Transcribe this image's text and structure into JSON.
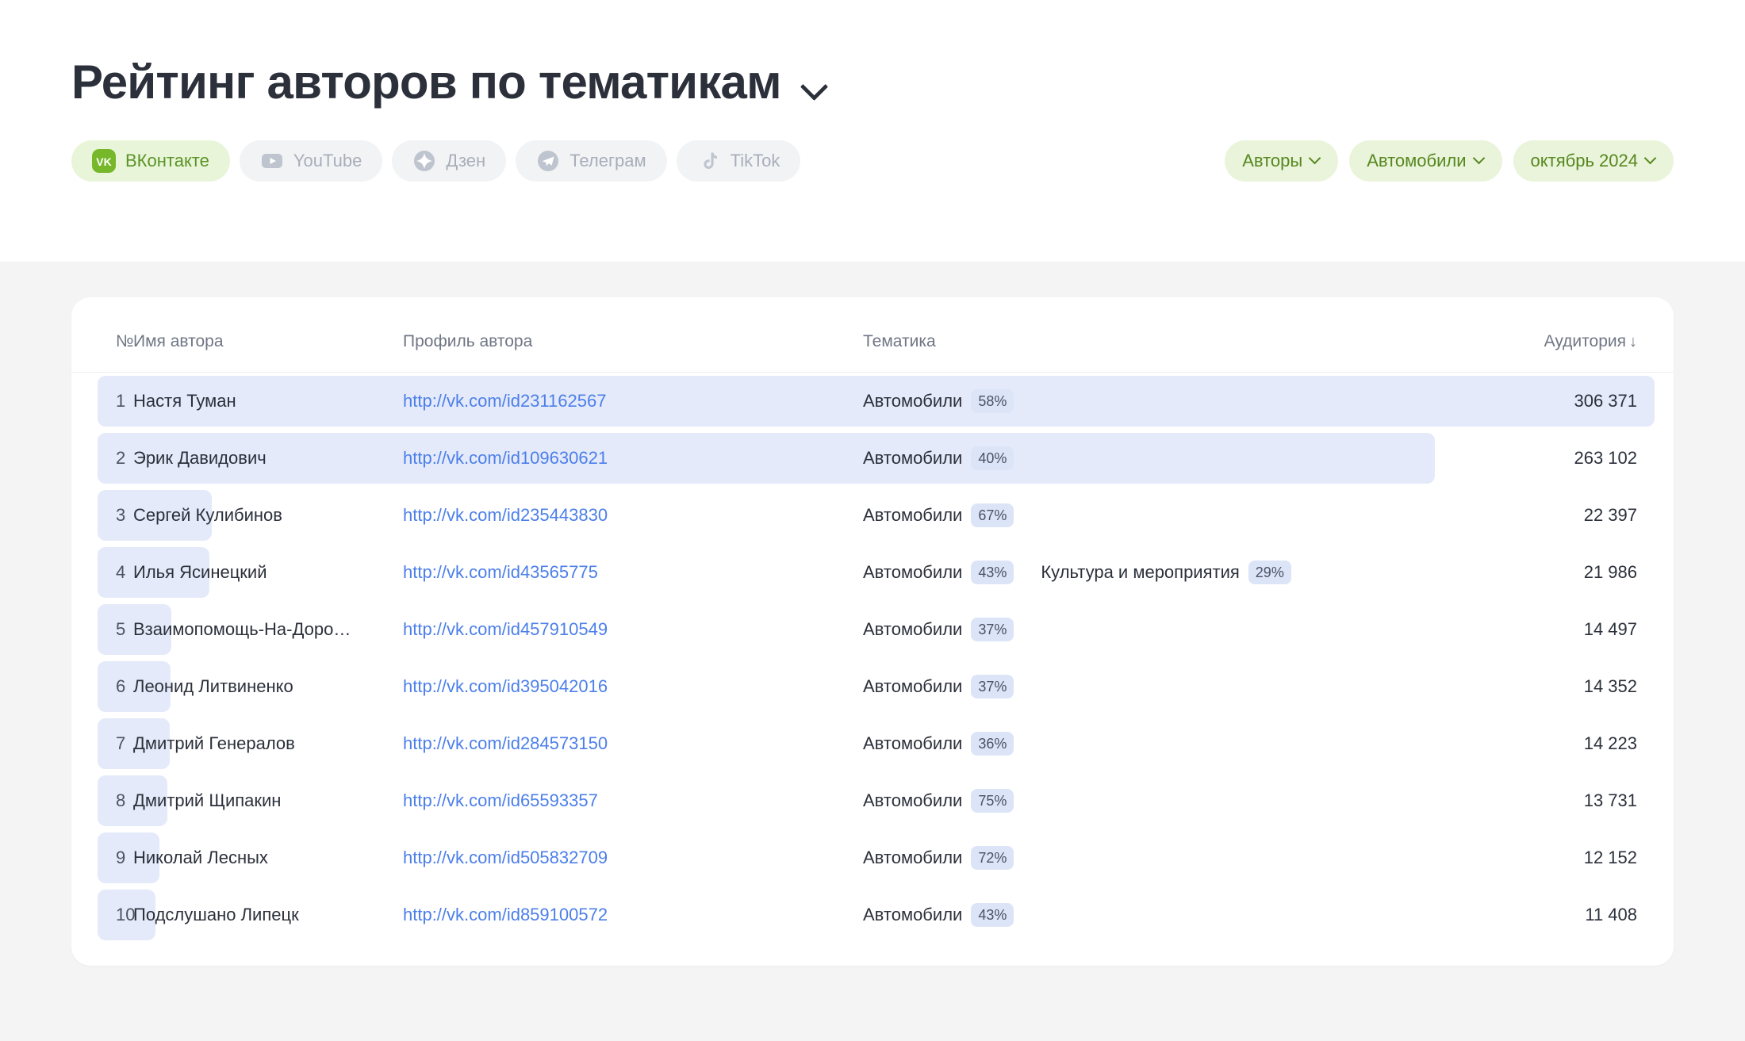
{
  "header": {
    "title": "Рейтинг авторов по тематикам",
    "title_chevron_icon": "chevron-down-icon"
  },
  "platforms": [
    {
      "label": "ВКонтакте",
      "icon": "vk-icon",
      "active": true
    },
    {
      "label": "YouTube",
      "icon": "youtube-icon",
      "active": false
    },
    {
      "label": "Дзен",
      "icon": "dzen-icon",
      "active": false
    },
    {
      "label": "Телеграм",
      "icon": "telegram-icon",
      "active": false
    },
    {
      "label": "TikTok",
      "icon": "tiktok-icon",
      "active": false
    }
  ],
  "filters": [
    {
      "label": "Авторы",
      "name": "entity-filter"
    },
    {
      "label": "Автомобили",
      "name": "topic-filter"
    },
    {
      "label": "октябрь 2024",
      "name": "period-filter"
    }
  ],
  "table": {
    "columns": {
      "num": "№",
      "name": "Имя автора",
      "profile": "Профиль автора",
      "topic": "Тематика",
      "audience": "Аудитория",
      "sort_arrow": "↓"
    },
    "rows": [
      {
        "num": "1",
        "name": "Настя Туман",
        "profile": "http://vk.com/id231162567",
        "topics": [
          {
            "label": "Автомобили",
            "pct": "58%"
          }
        ],
        "audience": "306 371",
        "audience_value": 306371
      },
      {
        "num": "2",
        "name": "Эрик Давидович",
        "profile": "http://vk.com/id109630621",
        "topics": [
          {
            "label": "Автомобили",
            "pct": "40%"
          }
        ],
        "audience": "263 102",
        "audience_value": 263102
      },
      {
        "num": "3",
        "name": "Сергей Кулибинов",
        "profile": "http://vk.com/id235443830",
        "topics": [
          {
            "label": "Автомобили",
            "pct": "67%"
          }
        ],
        "audience": "22 397",
        "audience_value": 22397
      },
      {
        "num": "4",
        "name": "Илья Ясинецкий",
        "profile": "http://vk.com/id43565775",
        "topics": [
          {
            "label": "Автомобили",
            "pct": "43%"
          },
          {
            "label": "Культура и мероприятия",
            "pct": "29%"
          }
        ],
        "audience": "21 986",
        "audience_value": 21986
      },
      {
        "num": "5",
        "name": "Взаимопомощь-На-Доро…",
        "profile": "http://vk.com/id457910549",
        "topics": [
          {
            "label": "Автомобили",
            "pct": "37%"
          }
        ],
        "audience": "14 497",
        "audience_value": 14497
      },
      {
        "num": "6",
        "name": "Леонид Литвиненко",
        "profile": "http://vk.com/id395042016",
        "topics": [
          {
            "label": "Автомобили",
            "pct": "37%"
          }
        ],
        "audience": "14 352",
        "audience_value": 14352
      },
      {
        "num": "7",
        "name": "Дмитрий Генералов",
        "profile": "http://vk.com/id284573150",
        "topics": [
          {
            "label": "Автомобили",
            "pct": "36%"
          }
        ],
        "audience": "14 223",
        "audience_value": 14223
      },
      {
        "num": "8",
        "name": "Дмитрий Щипакин",
        "profile": "http://vk.com/id65593357",
        "topics": [
          {
            "label": "Автомобили",
            "pct": "75%"
          }
        ],
        "audience": "13 731",
        "audience_value": 13731
      },
      {
        "num": "9",
        "name": "Николай Лесных",
        "profile": "http://vk.com/id505832709",
        "topics": [
          {
            "label": "Автомобили",
            "pct": "72%"
          }
        ],
        "audience": "12 152",
        "audience_value": 12152
      },
      {
        "num": "10",
        "name": "Подслушано Липецк",
        "profile": "http://vk.com/id859100572",
        "topics": [
          {
            "label": "Автомобили",
            "pct": "43%"
          }
        ],
        "audience": "11 408",
        "audience_value": 11408
      }
    ]
  },
  "colors": {
    "accent_green_bg": "#E9F4DA",
    "accent_green_text": "#57871F",
    "vk_green": "#76B82A",
    "link_blue": "#4C7FEA",
    "bar_blue": "#E4EAF9",
    "badge_blue": "#DCE4F8",
    "page_bg": "#F4F4F5",
    "card_bg": "#FFFFFF",
    "text_dark": "#2B303B",
    "text_muted": "#6F7684",
    "pill_inactive_bg": "#F2F3F5",
    "pill_inactive_text": "#A8AEBA"
  },
  "chart_data": {
    "type": "bar",
    "title": "Рейтинг авторов по тематикам",
    "xlabel": "Аудитория",
    "ylabel": "",
    "orientation": "horizontal",
    "categories": [
      "Настя Туман",
      "Эрик Давидович",
      "Сергей Кулибинов",
      "Илья Ясинецкий",
      "Взаимопомощь-На-Доро…",
      "Леонид Литвиненко",
      "Дмитрий Генералов",
      "Дмитрий Щипакин",
      "Николай Лесных",
      "Подслушано Липецк"
    ],
    "values": [
      306371,
      263102,
      22397,
      21986,
      14497,
      14352,
      14223,
      13731,
      12152,
      11408
    ],
    "xlim": [
      0,
      306371
    ],
    "grid": false,
    "legend": false
  }
}
